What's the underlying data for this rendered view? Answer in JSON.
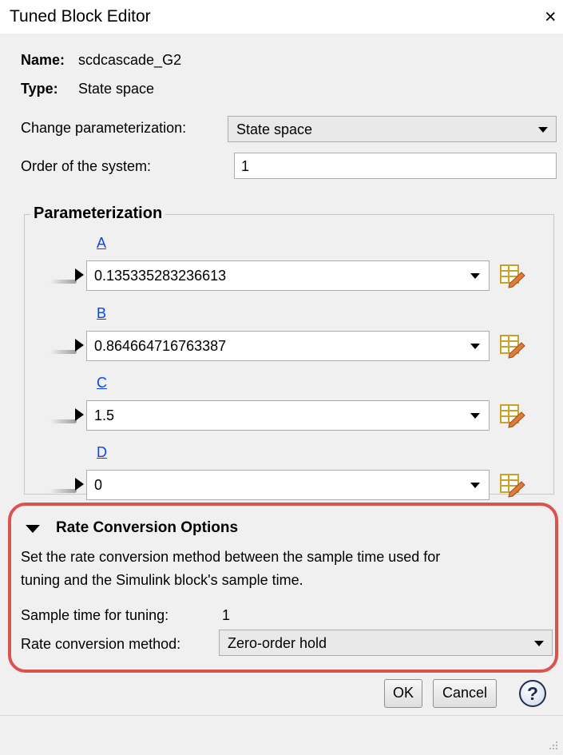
{
  "window": {
    "title": "Tuned Block Editor",
    "close_glyph": "×"
  },
  "block": {
    "name_label": "Name:",
    "name_value": "scdcascade_G2",
    "type_label": "Type:",
    "type_value": "State space"
  },
  "parameterization_select": {
    "label": "Change parameterization:",
    "value": "State space"
  },
  "order": {
    "label": "Order of the system:",
    "value": "1"
  },
  "parameterization": {
    "title": "Parameterization",
    "params": [
      {
        "label": "A",
        "value": "0.135335283236613"
      },
      {
        "label": "B",
        "value": "0.864664716763387"
      },
      {
        "label": "C",
        "value": "1.5"
      },
      {
        "label": "D",
        "value": "0"
      }
    ]
  },
  "rate_conversion": {
    "title": "Rate Conversion Options",
    "description_line1": "Set the rate conversion method between the sample time used for",
    "description_line2": "tuning and the Simulink block's sample time.",
    "sample_time_label": "Sample time for tuning:",
    "sample_time_value": "1",
    "method_label": "Rate conversion method:",
    "method_value": "Zero-order hold"
  },
  "buttons": {
    "ok": "OK",
    "cancel": "Cancel",
    "help": "?"
  },
  "icons": {
    "close": "close-icon",
    "expand": "triangle-right-icon",
    "collapse": "triangle-down-icon",
    "edit": "table-edit-icon",
    "help": "help-icon",
    "dropdown": "chevron-down-icon",
    "grip": "resize-grip-icon"
  },
  "colors": {
    "highlight": "#d9534f",
    "link": "#0645ff",
    "background": "#f0f0f0"
  }
}
